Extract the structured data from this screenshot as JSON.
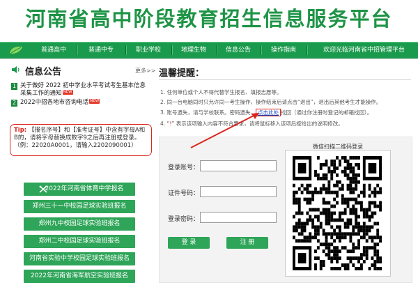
{
  "header": {
    "title": "河南省高中阶段教育招生信息服务平台"
  },
  "nav": {
    "items": [
      "普通高中",
      "普通中专",
      "职业学校",
      "地理生物",
      "信息公告",
      "操作指南",
      "欢迎光临河南省中招管理平台"
    ]
  },
  "notice": {
    "title": "信息公告",
    "more": "更多>>",
    "items": [
      {
        "num": "1",
        "text": "关于做好 2022 初中学业水平考试考生基本信息采集工作的通知",
        "badge": "NEW"
      },
      {
        "num": "2",
        "text": "2022中招各地市咨询电话",
        "badge": "NEW"
      }
    ]
  },
  "tip": {
    "label": "Tip:",
    "text": "【报名序号】和【准考证号】中含有字母A和B的，请将字母替换成数字9之后再注册或登录。（例：22020A0001，请输入2202090001）"
  },
  "links": [
    "2022年河南省体育中学报名",
    "郑州三十一中校园足球实验班报名",
    "郑州九中校园足球实验班报名",
    "郑州二中校园足球实验班报名",
    "河南省实验中学校园足球实验班报名",
    "2022年河南省海军航空实验班报名"
  ],
  "reminder": {
    "title": "温馨提醒：",
    "rule1": "1. 任何单位或个人不得代替学生报名、填报志愿等。",
    "rule2": "2. 同一台电脑同时只允许同一考生操作，操作结束后请点击“退出”，退出后其他考生才能操作。",
    "rule3_before": "3. 账号遗失，请与学校联系。密码遗失，",
    "rule3_link": "点击此处",
    "rule3_after": "找回（通过你注册时登记的邮箱找回）。",
    "rule4_num": "4. “",
    "rule4_icon": "!",
    "rule4_text": "” 表示该项输入内容不符合要求，请将鼠标移入该项后按给出的说明修改。"
  },
  "login": {
    "account_label": "登录账号：",
    "id_label": "证件号码：",
    "password_label": "登录密码：",
    "login_button": "登 录",
    "register_button": "注 册",
    "qr_title": "微信扫描二维码登录"
  },
  "colors": {
    "brand": "#1a9a4c",
    "accent_red": "#d9261c",
    "link": "#1a46c4"
  }
}
